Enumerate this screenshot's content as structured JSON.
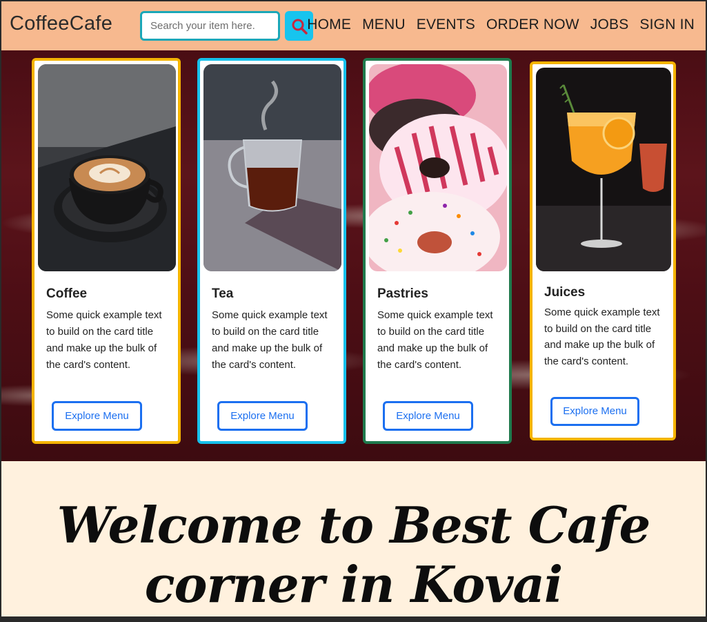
{
  "navbar": {
    "brand": "CoffeeCafe",
    "search_placeholder": "Search your item here.",
    "links": [
      "HOME",
      "MENU",
      "EVENTS",
      "ORDER NOW",
      "JOBS",
      "SIGN IN"
    ]
  },
  "cards": [
    {
      "title": "Coffee",
      "text": "Some quick example text to build on the card title and make up the bulk of the card's content.",
      "button": "Explore Menu",
      "border_color": "#f5b400"
    },
    {
      "title": "Tea",
      "text": "Some quick example text to build on the card title and make up the bulk of the card's content.",
      "button": "Explore Menu",
      "border_color": "#16c1ec"
    },
    {
      "title": "Pastries",
      "text": "Some quick example text to build on the card title and make up the bulk of the card's content.",
      "button": "Explore Menu",
      "border_color": "#1f7a4d"
    },
    {
      "title": "Juices",
      "text": "Some quick example text to build on the card title and make up the bulk of the card's content.",
      "button": "Explore Menu",
      "border_color": "#f5b400"
    }
  ],
  "welcome": {
    "text": "Welcome to Best Cafe corner in Kovai"
  },
  "colors": {
    "navbar_bg": "#f7b98f",
    "search_button": "#17c4ee",
    "button_blue": "#1b6ff0",
    "welcome_bg": "#fff1de"
  }
}
